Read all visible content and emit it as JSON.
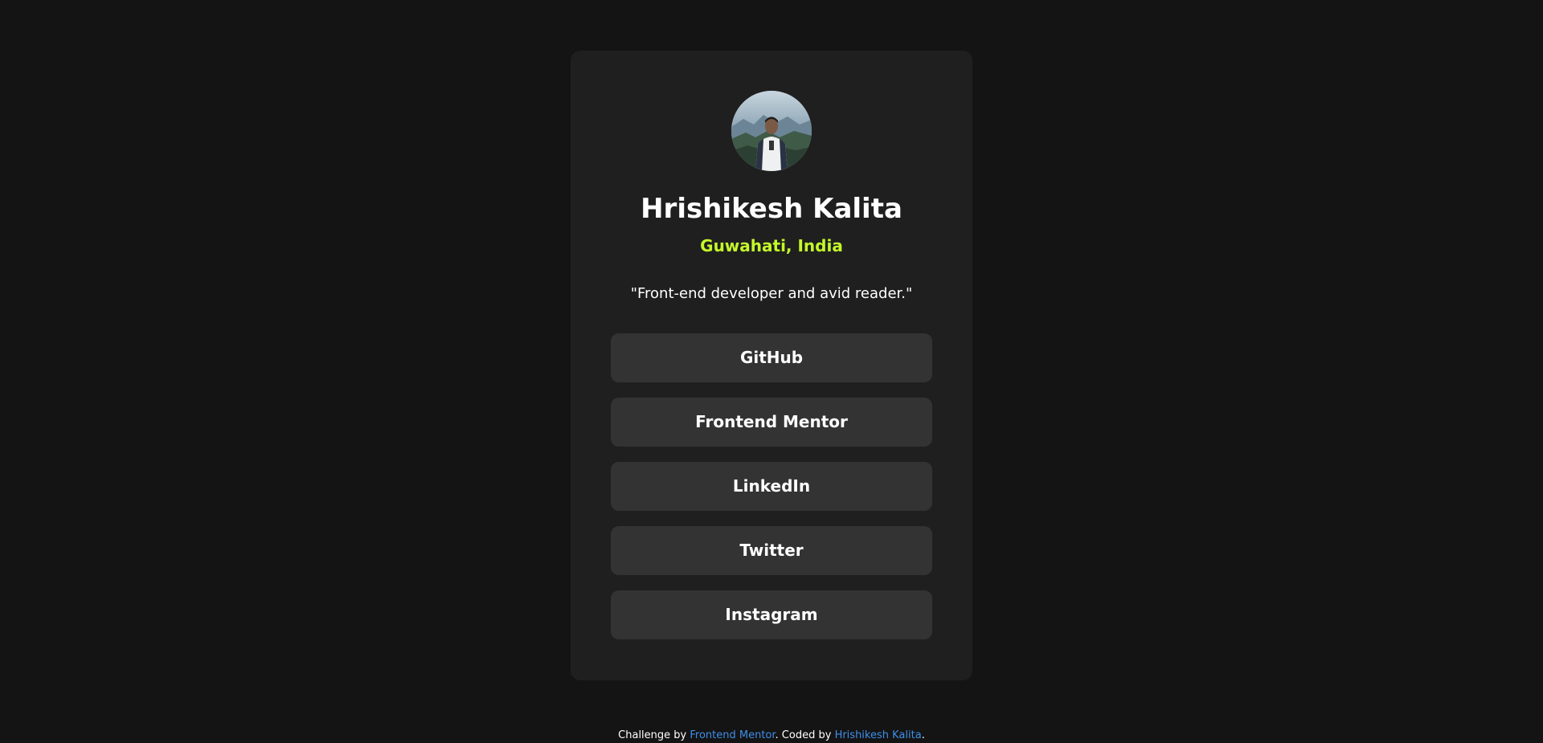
{
  "profile": {
    "avatar_alt": "Hrishikesh Kalita",
    "name": "Hrishikesh Kalita",
    "location": "Guwahati, India",
    "bio": "\"Front-end developer and avid reader.\""
  },
  "links": [
    {
      "label": "GitHub"
    },
    {
      "label": "Frontend Mentor"
    },
    {
      "label": "LinkedIn"
    },
    {
      "label": "Twitter"
    },
    {
      "label": "Instagram"
    }
  ],
  "footer": {
    "prefix": "Challenge by ",
    "challenge_link": "Frontend Mentor",
    "middle": ". Coded by ",
    "author_link": "Hrishikesh Kalita",
    "suffix": "."
  },
  "colors": {
    "background": "#141414",
    "card": "#1f1f1f",
    "button": "#333333",
    "accent": "#c4f82a",
    "link": "#3e8ee8"
  }
}
